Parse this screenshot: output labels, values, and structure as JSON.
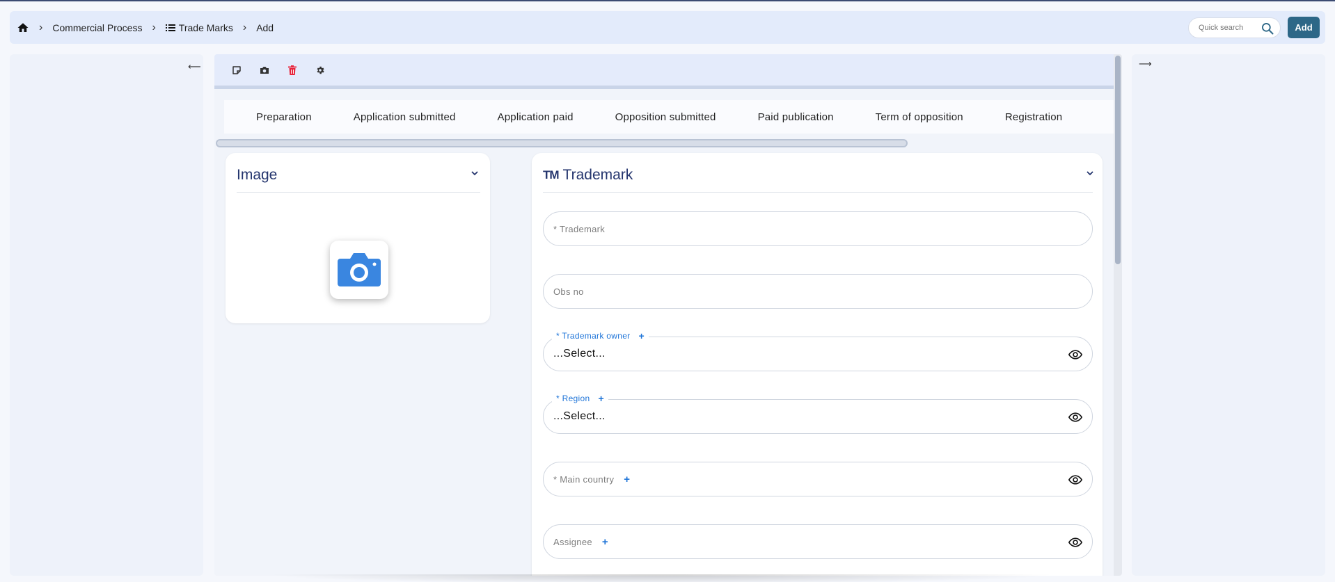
{
  "breadcrumb": {
    "items": [
      "Commercial Process",
      "Trade Marks",
      "Add"
    ]
  },
  "search": {
    "placeholder": "Quick search"
  },
  "header": {
    "add_label": "Add"
  },
  "toolbar": {
    "icons": [
      "note-icon",
      "camera-icon",
      "trash-icon",
      "gear-icon"
    ],
    "delete_color": "#e8263d"
  },
  "steps": [
    "Preparation",
    "Application submitted",
    "Application paid",
    "Opposition submitted",
    "Paid publication",
    "Term of opposition",
    "Registration"
  ],
  "image_card": {
    "title": "Image"
  },
  "trademark_card": {
    "badge": "TM",
    "title": "Trademark",
    "fields": {
      "trademark": {
        "placeholder": "* Trademark"
      },
      "obs_no": {
        "placeholder": "Obs no"
      },
      "owner": {
        "label": "* Trademark owner",
        "value": "...Select..."
      },
      "region": {
        "label": "* Region",
        "value": "...Select..."
      },
      "main_country": {
        "placeholder": "* Main country"
      },
      "assignee": {
        "placeholder": "Assignee"
      }
    }
  },
  "colors": {
    "accent": "#1e74d8",
    "title": "#24356e",
    "add_button": "#2d6787",
    "header_bg": "#e3ebfb"
  }
}
